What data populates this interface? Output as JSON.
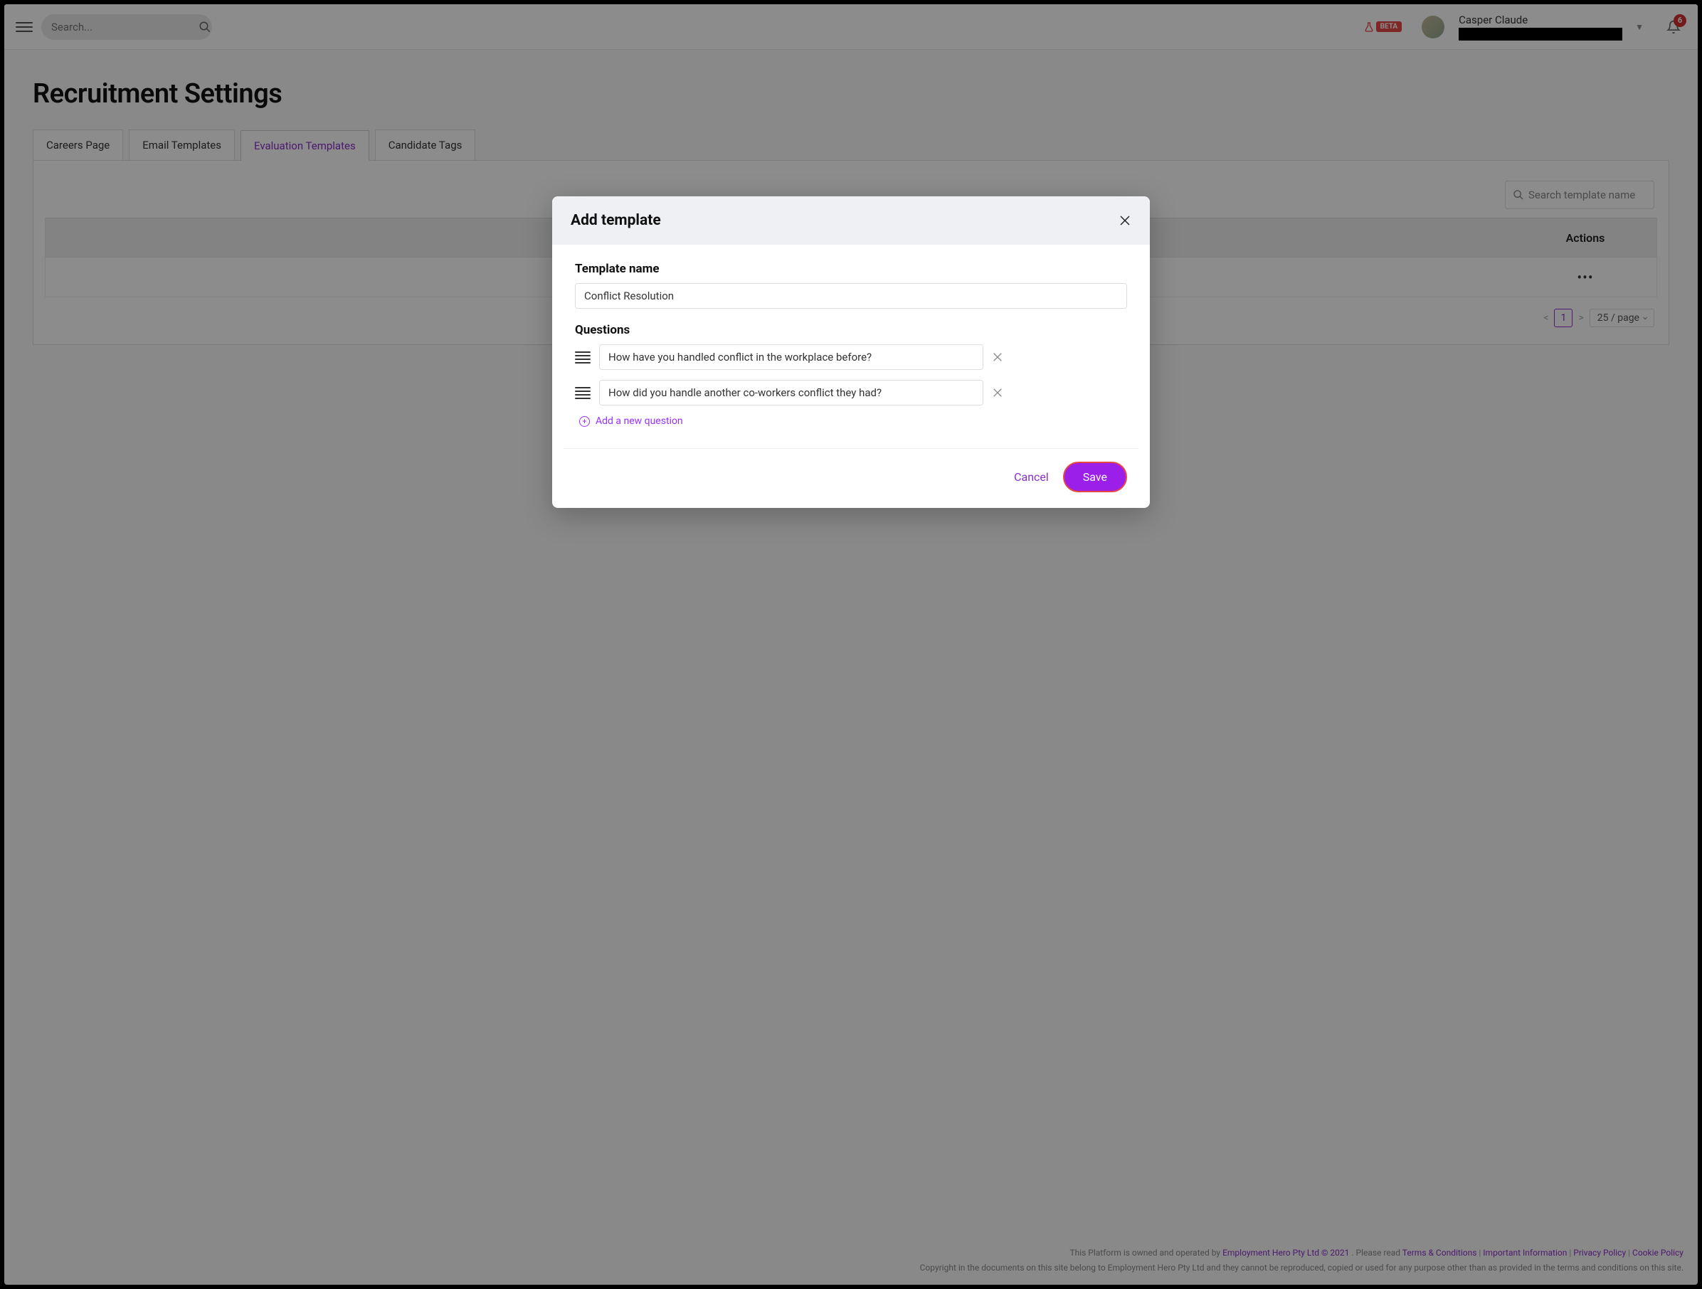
{
  "header": {
    "search_placeholder": "Search...",
    "beta_label": "BETA",
    "user_name": "Casper Claude",
    "notification_count": "6"
  },
  "page": {
    "title": "Recruitment Settings",
    "tabs": [
      {
        "label": "Careers Page"
      },
      {
        "label": "Email Templates"
      },
      {
        "label": "Evaluation Templates"
      },
      {
        "label": "Candidate Tags"
      }
    ],
    "search_template_placeholder": "Search template name",
    "col_actions": "Actions",
    "row_actions_glyph": "•••",
    "pager": {
      "prev": "<",
      "page": "1",
      "next": ">",
      "size": "25 / page"
    }
  },
  "modal": {
    "title": "Add template",
    "template_name_label": "Template name",
    "template_name_value": "Conflict Resolution",
    "questions_label": "Questions",
    "questions": [
      "How have you handled conflict in the workplace before?",
      "How did you handle another co-workers conflict they had?"
    ],
    "add_question_label": "Add a new question",
    "cancel_label": "Cancel",
    "save_label": "Save"
  },
  "footer": {
    "line1_a": "This Platform is owned and operated by ",
    "line1_link": "Employment Hero Pty Ltd © 2021",
    "line1_b": ". Please read ",
    "terms": "Terms & Conditions",
    "important": "Important Information",
    "privacy": "Privacy Policy",
    "cookie": "Cookie Policy",
    "line2": "Copyright in the documents on this site belong to Employment Hero Pty Ltd and they cannot be reproduced, copied or used for any purpose other than as provided in the terms and conditions on this site."
  }
}
